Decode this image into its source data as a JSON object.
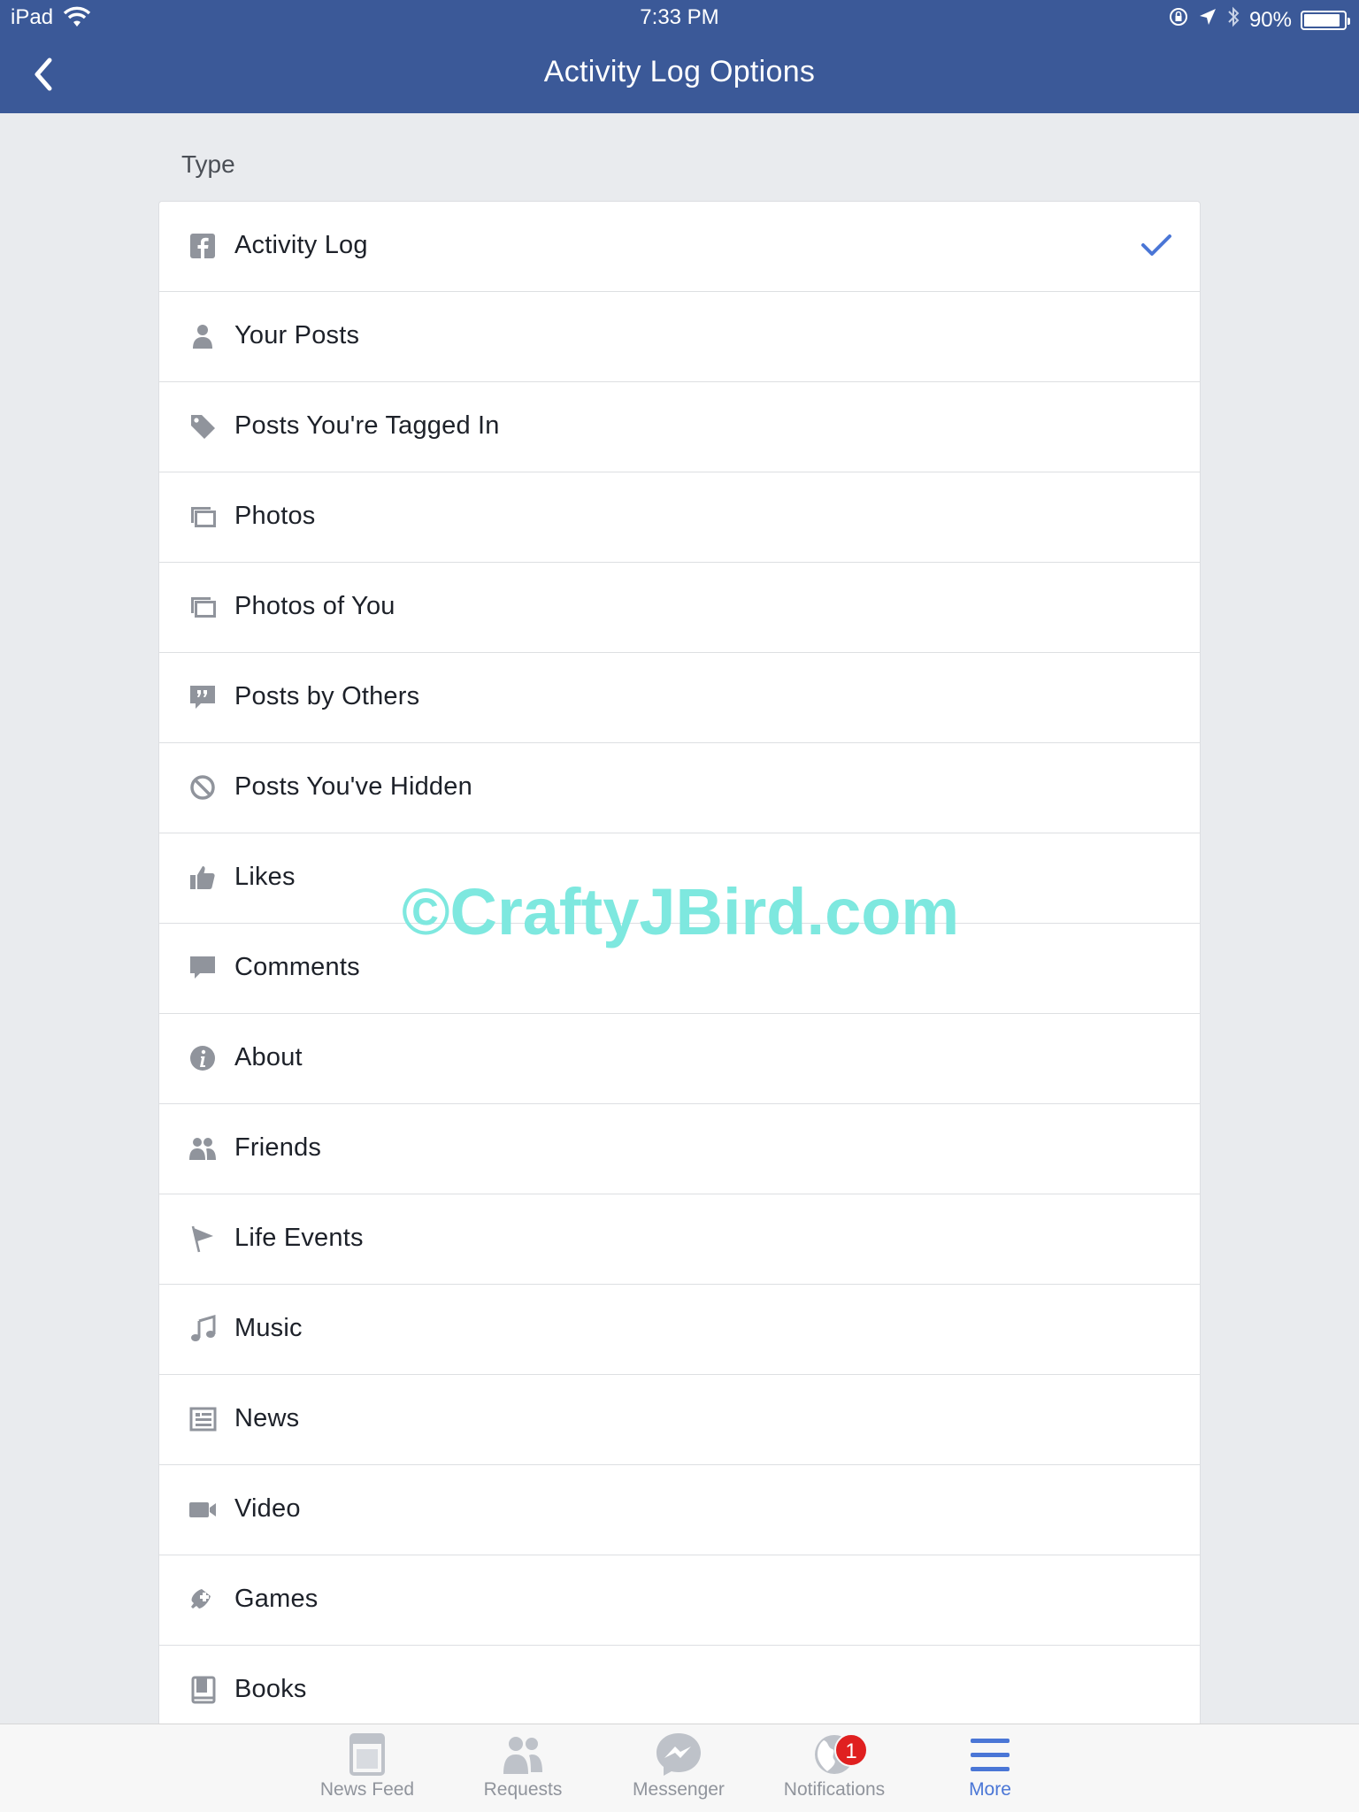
{
  "status_bar": {
    "carrier": "iPad",
    "time": "7:33 PM",
    "battery_text": "90%",
    "battery_level": 0.9
  },
  "nav": {
    "title": "Activity Log Options",
    "back_icon": "chevron-left-icon"
  },
  "section": {
    "label": "Type"
  },
  "items": [
    {
      "label": "Activity Log",
      "icon": "facebook-icon",
      "selected": true
    },
    {
      "label": "Your Posts",
      "icon": "person-icon"
    },
    {
      "label": "Posts You're Tagged In",
      "icon": "tag-icon"
    },
    {
      "label": "Photos",
      "icon": "photos-icon"
    },
    {
      "label": "Photos of You",
      "icon": "photos-icon"
    },
    {
      "label": "Posts by Others",
      "icon": "quote-bubble-icon"
    },
    {
      "label": "Posts You've Hidden",
      "icon": "hidden-icon"
    },
    {
      "label": "Likes",
      "icon": "thumbs-up-icon"
    },
    {
      "label": "Comments",
      "icon": "comment-icon"
    },
    {
      "label": "About",
      "icon": "info-icon"
    },
    {
      "label": "Friends",
      "icon": "friends-icon"
    },
    {
      "label": "Life Events",
      "icon": "flag-icon"
    },
    {
      "label": "Music",
      "icon": "music-note-icon"
    },
    {
      "label": "News",
      "icon": "news-icon"
    },
    {
      "label": "Video",
      "icon": "video-camera-icon"
    },
    {
      "label": "Games",
      "icon": "game-controller-icon"
    },
    {
      "label": "Books",
      "icon": "book-icon"
    }
  ],
  "watermark": "©CraftyJBird.com",
  "tabbar": {
    "tabs": [
      {
        "label": "News Feed",
        "icon": "news-feed-icon"
      },
      {
        "label": "Requests",
        "icon": "friend-requests-icon"
      },
      {
        "label": "Messenger",
        "icon": "messenger-icon"
      },
      {
        "label": "Notifications",
        "icon": "globe-icon",
        "badge": "1"
      },
      {
        "label": "More",
        "icon": "menu-icon",
        "active": true
      }
    ]
  },
  "colors": {
    "header": "#3b5998",
    "accent": "#4a76d6",
    "badge": "#e02020",
    "icon_gray": "#90949c"
  }
}
